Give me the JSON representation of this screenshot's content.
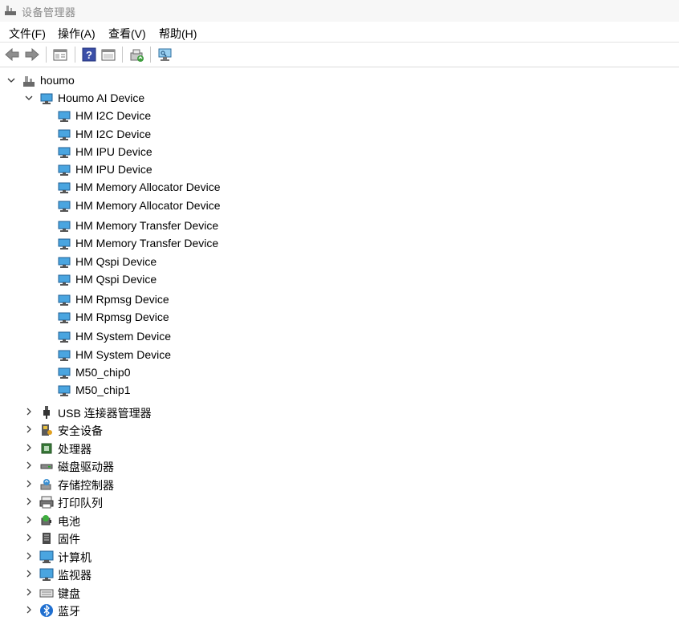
{
  "window": {
    "title": "设备管理器",
    "icon": "device-manager-icon"
  },
  "menu": [
    {
      "label": "文件(F)"
    },
    {
      "label": "操作(A)"
    },
    {
      "label": "查看(V)"
    },
    {
      "label": "帮助(H)"
    }
  ],
  "toolbar": {
    "back": "back-arrow-icon",
    "forward": "forward-arrow-icon",
    "properties": "properties-icon",
    "help": "help-icon",
    "console": "console-icon",
    "update_driver": "update-driver-icon",
    "scan": "scan-hardware-icon"
  },
  "tree": {
    "root": {
      "label": "houmo",
      "expanded": true
    },
    "houmo_ai": {
      "label": "Houmo AI Device",
      "expanded": true
    },
    "devices": [
      {
        "label": "HM I2C Device"
      },
      {
        "label": "HM I2C Device"
      },
      {
        "label": "HM IPU Device"
      },
      {
        "label": "HM IPU Device"
      },
      {
        "label": "HM Memory Allocator Device"
      },
      {
        "label": "HM Memory Allocator Device"
      },
      {
        "label": "HM Memory Transfer Device"
      },
      {
        "label": "HM Memory Transfer Device"
      },
      {
        "label": "HM Qspi Device"
      },
      {
        "label": "HM Qspi Device"
      },
      {
        "label": "HM Rpmsg Device"
      },
      {
        "label": "HM Rpmsg Device"
      },
      {
        "label": "HM System Device"
      },
      {
        "label": "HM System Device"
      },
      {
        "label": "M50_chip0"
      },
      {
        "label": "M50_chip1"
      }
    ],
    "categories": [
      {
        "label": "USB 连接器管理器",
        "icon": "usb-icon"
      },
      {
        "label": "安全设备",
        "icon": "security-device-icon"
      },
      {
        "label": "处理器",
        "icon": "processor-icon"
      },
      {
        "label": "磁盘驱动器",
        "icon": "disk-drive-icon"
      },
      {
        "label": "存储控制器",
        "icon": "storage-controller-icon"
      },
      {
        "label": "打印队列",
        "icon": "printer-icon"
      },
      {
        "label": "电池",
        "icon": "battery-icon"
      },
      {
        "label": "固件",
        "icon": "firmware-icon"
      },
      {
        "label": "计算机",
        "icon": "computer-icon"
      },
      {
        "label": "监视器",
        "icon": "monitor-icon"
      },
      {
        "label": "键盘",
        "icon": "keyboard-icon"
      },
      {
        "label": "蓝牙",
        "icon": "bluetooth-icon"
      }
    ]
  }
}
